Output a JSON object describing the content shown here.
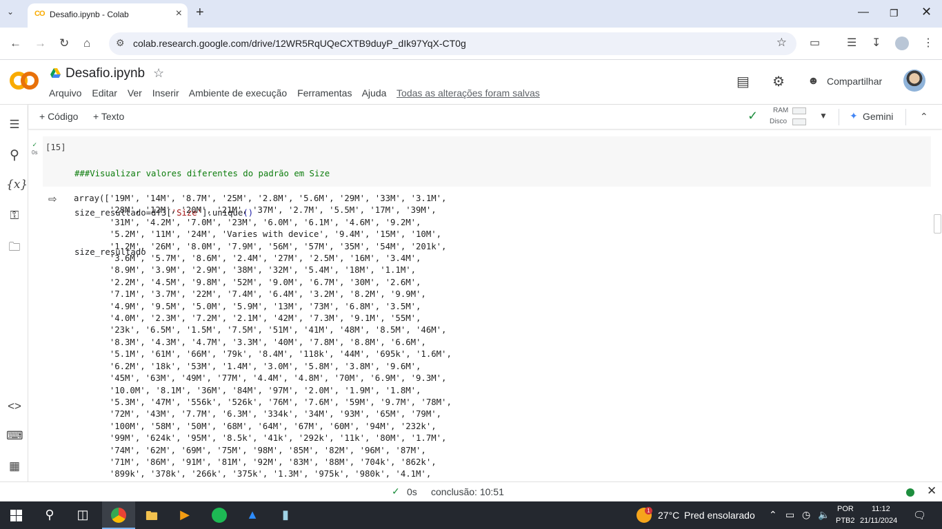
{
  "browser": {
    "tab_title": "Desafio.ipynb - Colab",
    "favicon_text": "CO",
    "url": "colab.research.google.com/drive/12WR5RqUQeCXTB9duyP_dIk97YqX-CT0g"
  },
  "colab": {
    "doc_name": "Desafio.ipynb",
    "menu": [
      "Arquivo",
      "Editar",
      "Ver",
      "Inserir",
      "Ambiente de execução",
      "Ferramentas",
      "Ajuda"
    ],
    "save_status": "Todas as alterações foram salvas",
    "share_label": "Compartilhar"
  },
  "toolbar": {
    "add_code": "+ Código",
    "add_text": "+ Texto",
    "ram_label": "RAM",
    "disk_label": "Disco",
    "gemini_label": "Gemini"
  },
  "cell": {
    "status_time": "0s",
    "exec_count": "[15]",
    "code_comment": "###Visualizar valores diferentes do padrão em Size",
    "code_line2_a": "size_resultado=df3[",
    "code_line2_str": "'Size'",
    "code_line2_b": "].unique",
    "code_line2_paren": "()",
    "code_line3": "size_resultado",
    "output_lines": [
      "array(['19M', '14M', '8.7M', '25M', '2.8M', '5.6M', '29M', '33M', '3.1M',",
      "       '28M', '12M', '20M', '21M', '37M', '2.7M', '5.5M', '17M', '39M',",
      "       '31M', '4.2M', '7.0M', '23M', '6.0M', '6.1M', '4.6M', '9.2M',",
      "       '5.2M', '11M', '24M', 'Varies with device', '9.4M', '15M', '10M',",
      "       '1.2M', '26M', '8.0M', '7.9M', '56M', '57M', '35M', '54M', '201k',",
      "       '3.6M', '5.7M', '8.6M', '2.4M', '27M', '2.5M', '16M', '3.4M',",
      "       '8.9M', '3.9M', '2.9M', '38M', '32M', '5.4M', '18M', '1.1M',",
      "       '2.2M', '4.5M', '9.8M', '52M', '9.0M', '6.7M', '30M', '2.6M',",
      "       '7.1M', '3.7M', '22M', '7.4M', '6.4M', '3.2M', '8.2M', '9.9M',",
      "       '4.9M', '9.5M', '5.0M', '5.9M', '13M', '73M', '6.8M', '3.5M',",
      "       '4.0M', '2.3M', '7.2M', '2.1M', '42M', '7.3M', '9.1M', '55M',",
      "       '23k', '6.5M', '1.5M', '7.5M', '51M', '41M', '48M', '8.5M', '46M',",
      "       '8.3M', '4.3M', '4.7M', '3.3M', '40M', '7.8M', '8.8M', '6.6M',",
      "       '5.1M', '61M', '66M', '79k', '8.4M', '118k', '44M', '695k', '1.6M',",
      "       '6.2M', '18k', '53M', '1.4M', '3.0M', '5.8M', '3.8M', '9.6M',",
      "       '45M', '63M', '49M', '77M', '4.4M', '4.8M', '70M', '6.9M', '9.3M',",
      "       '10.0M', '8.1M', '36M', '84M', '97M', '2.0M', '1.9M', '1.8M',",
      "       '5.3M', '47M', '556k', '526k', '76M', '7.6M', '59M', '9.7M', '78M',",
      "       '72M', '43M', '7.7M', '6.3M', '334k', '34M', '93M', '65M', '79M',",
      "       '100M', '58M', '50M', '68M', '64M', '67M', '60M', '94M', '232k',",
      "       '99M', '624k', '95M', '8.5k', '41k', '292k', '11k', '80M', '1.7M',",
      "       '74M', '62M', '69M', '75M', '98M', '85M', '82M', '96M', '87M',",
      "       '71M', '86M', '91M', '81M', '92M', '83M', '88M', '704k', '862k',",
      "       '899k', '378k', '266k', '375k', '1.3M', '975k', '980k', '4.1M',"
    ]
  },
  "statusbar": {
    "time": "0s",
    "done": "conclusão: 10:51"
  },
  "taskbar": {
    "weather_temp": "27°C",
    "weather_desc": "Pred ensolarado",
    "weather_badge": "1",
    "lang_1": "POR",
    "lang_2": "PTB2",
    "time": "11:12",
    "date": "21/11/2024"
  },
  "colors": {
    "accent_green": "#1e8e3e",
    "colab_orange": "#f9ab00",
    "tabstrip": "#dfe6f5"
  }
}
